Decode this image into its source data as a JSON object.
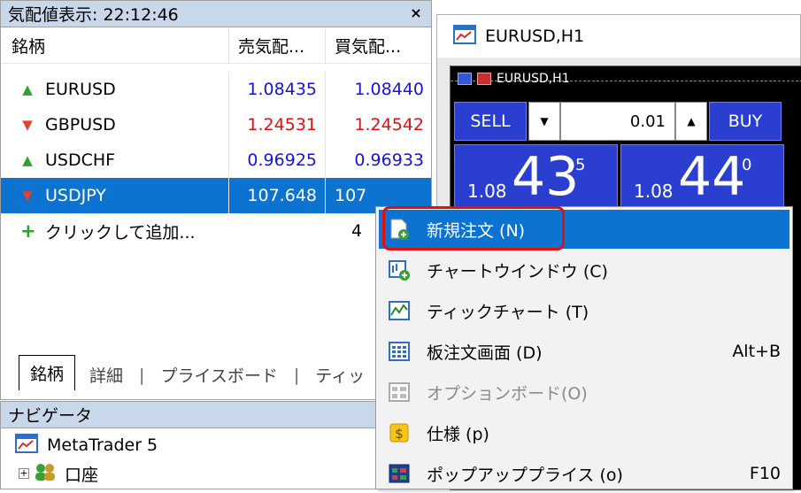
{
  "market_watch": {
    "title": "気配値表示: 22:12:46",
    "close": "×",
    "headers": {
      "symbol": "銘柄",
      "bid": "売気配...",
      "ask": "買気配..."
    },
    "rows": [
      {
        "symbol": "EURUSD",
        "direction": "up",
        "bid": "1.08435",
        "ask": "1.08440",
        "color": "#1515d8"
      },
      {
        "symbol": "GBPUSD",
        "direction": "down",
        "bid": "1.24531",
        "ask": "1.24542",
        "color": "#e01010"
      },
      {
        "symbol": "USDCHF",
        "direction": "up",
        "bid": "0.96925",
        "ask": "0.96933",
        "color": "#1515d8"
      },
      {
        "symbol": "USDJPY",
        "direction": "down",
        "bid": "107.648",
        "ask": "107",
        "selected": true
      }
    ],
    "add_row": {
      "label": "クリックして追加...",
      "count": "4"
    },
    "tabs": [
      "銘柄",
      "詳細",
      "プライスボード",
      "ティッ"
    ]
  },
  "navigator": {
    "title": "ナビゲータ",
    "items": [
      "MetaTrader 5",
      "口座"
    ]
  },
  "chart_window": {
    "title": "EURUSD,H1",
    "chart_label": "EURUSD,H1",
    "one_click": {
      "sell": "SELL",
      "buy": "BUY",
      "lot": "0.01",
      "sell_price_small": "1.08",
      "sell_price_big": "43",
      "sell_price_sup": "5",
      "buy_price_small": "1.08",
      "buy_price_big": "44",
      "buy_price_sup": "0"
    }
  },
  "context_menu": {
    "items": [
      {
        "label": "新規注文 (N)",
        "shortcut": "",
        "icon": "new-order-icon",
        "highlighted": true
      },
      {
        "label": "チャートウインドウ (C)",
        "shortcut": "",
        "icon": "chart-window-icon"
      },
      {
        "label": "ティックチャート (T)",
        "shortcut": "",
        "icon": "tick-chart-icon"
      },
      {
        "label": "板注文画面 (D)",
        "shortcut": "Alt+B",
        "icon": "depth-of-market-icon"
      },
      {
        "label": "オプションボード(O)",
        "shortcut": "",
        "icon": "option-board-icon",
        "disabled": true
      },
      {
        "label": "仕様 (p)",
        "shortcut": "",
        "icon": "specification-icon"
      },
      {
        "label": "ポップアッププライス (o)",
        "shortcut": "F10",
        "icon": "popup-prices-icon"
      }
    ]
  },
  "colors": {
    "accent": "#0c74d0",
    "highlight_frame": "#e01010",
    "title_bar": "#c9d7ea"
  }
}
